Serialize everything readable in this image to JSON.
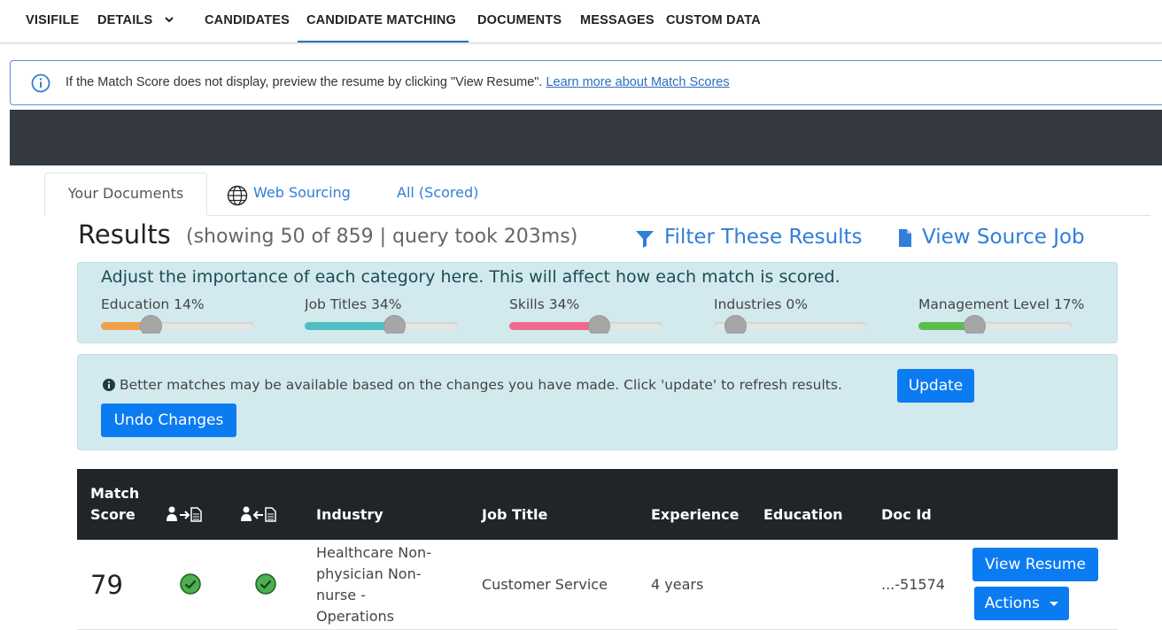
{
  "nav": {
    "items": [
      "VISIFILE",
      "DETAILS",
      "CANDIDATES",
      "CANDIDATE MATCHING",
      "DOCUMENTS",
      "MESSAGES",
      "CUSTOM DATA"
    ],
    "active": "CANDIDATE MATCHING"
  },
  "info_bar": {
    "text": "If the Match Score does not display, preview the resume by clicking \"View Resume\".",
    "link": "Learn more about Match Scores"
  },
  "tabs": {
    "your_documents": "Your Documents",
    "web_sourcing": "Web Sourcing",
    "all_scored": "All (Scored)"
  },
  "results": {
    "title": "Results",
    "subtitle": "(showing 50 of 859 | query took 203ms)",
    "filter_link": "Filter These Results",
    "source_link": "View Source Job"
  },
  "weights": {
    "heading": "Adjust the importance of each category here. This will affect how each match is scored.",
    "sliders": [
      {
        "label": "Education 14%",
        "value": 14,
        "color": "#f0a04b"
      },
      {
        "label": "Job Titles 34%",
        "value": 34,
        "color": "#4fbfc4"
      },
      {
        "label": "Skills 34%",
        "value": 34,
        "color": "#f06a8a"
      },
      {
        "label": "Industries 0%",
        "value": 0,
        "color": "#cccccc"
      },
      {
        "label": "Management Level 17%",
        "value": 17,
        "color": "#5cbd4d"
      }
    ]
  },
  "alert": {
    "text": "Better matches may be available based on the changes you have made. Click 'update' to refresh results.",
    "update_label": "Update",
    "undo_label": "Undo Changes"
  },
  "table": {
    "headers": {
      "match_line1": "Match",
      "match_line2": "Score",
      "industry": "Industry",
      "job_title": "Job Title",
      "experience": "Experience",
      "education": "Education",
      "doc_id": "Doc Id"
    },
    "rows": [
      {
        "score": "79",
        "industry_lines": [
          "Healthcare Non-",
          "physician Non-",
          "nurse -",
          "Operations"
        ],
        "job_title": "Customer Service",
        "experience": "4 years",
        "education": "",
        "doc_id": "...-51574",
        "view_label": "View Resume",
        "actions_label": "Actions"
      }
    ]
  },
  "colors": {
    "primary": "#0b7bf2",
    "link": "#2f7fd8",
    "panel": "#d2eaee",
    "dark": "#212529",
    "check": "#4caf50"
  }
}
